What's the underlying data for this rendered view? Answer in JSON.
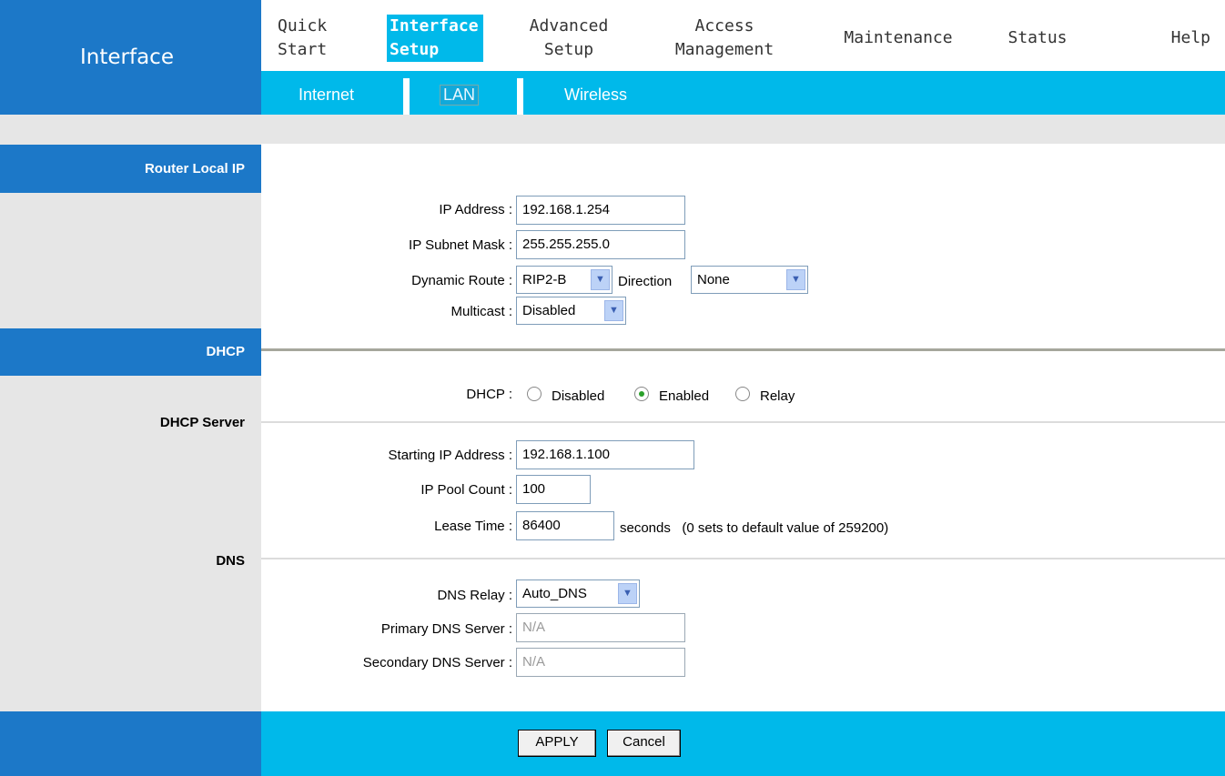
{
  "brand": {
    "title": "Interface"
  },
  "nav": {
    "quick_start": "Quick\nStart",
    "interface_setup": "Interface\nSetup",
    "advanced_setup": "Advanced\nSetup",
    "access_management": "Access\nManagement",
    "maintenance": "Maintenance",
    "status": "Status",
    "help": "Help"
  },
  "subnav": {
    "internet": "Internet",
    "lan": "LAN",
    "wireless": "Wireless"
  },
  "sections": {
    "router_local_ip": "Router Local IP",
    "dhcp": "DHCP",
    "dhcp_server": "DHCP Server",
    "dns": "DNS"
  },
  "router": {
    "ip_address_label": "IP Address :",
    "ip_address": "192.168.1.254",
    "subnet_mask_label": "IP Subnet Mask :",
    "subnet_mask": "255.255.255.0",
    "dynamic_route_label": "Dynamic Route :",
    "dynamic_route": "RIP2-B",
    "direction_label": "Direction",
    "direction": "None",
    "multicast_label": "Multicast :",
    "multicast": "Disabled"
  },
  "dhcp": {
    "label": "DHCP :",
    "options": [
      "Disabled",
      "Enabled",
      "Relay"
    ],
    "selected": "Enabled",
    "starting_ip_label": "Starting IP Address :",
    "starting_ip": "192.168.1.100",
    "pool_count_label": "IP Pool Count :",
    "pool_count": "100",
    "lease_time_label": "Lease Time :",
    "lease_time": "86400",
    "lease_note": "seconds   (0 sets to default value of 259200)"
  },
  "dns": {
    "relay_label": "DNS Relay :",
    "relay": "Auto_DNS",
    "primary_label": "Primary DNS Server :",
    "primary": "N/A",
    "secondary_label": "Secondary DNS Server :",
    "secondary": "N/A"
  },
  "buttons": {
    "apply": "APPLY",
    "cancel": "Cancel"
  },
  "colors": {
    "brand_blue": "#1c78c8",
    "accent_cyan": "#00b9ea",
    "panel_gray": "#e6e6e6"
  }
}
